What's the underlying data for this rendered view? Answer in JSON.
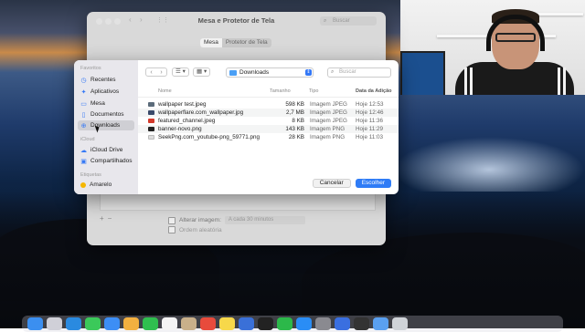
{
  "settings_window": {
    "title": "Mesa e Protetor de Tela",
    "search_placeholder": "Buscar",
    "tabs": [
      {
        "label": "Mesa",
        "active": true
      },
      {
        "label": "Protetor de Tela",
        "active": false
      }
    ],
    "change_picture_label": "Alterar imagem:",
    "change_picture_value": "A cada 30 minutos",
    "random_order_label": "Ordem aleatória"
  },
  "file_dialog": {
    "sidebar": {
      "favorites_header": "Favoritos",
      "favorites": [
        {
          "label": "Recentes",
          "icon": "clock-icon"
        },
        {
          "label": "Aplicativos",
          "icon": "apps-icon"
        },
        {
          "label": "Mesa",
          "icon": "desktop-icon"
        },
        {
          "label": "Documentos",
          "icon": "document-icon"
        },
        {
          "label": "Downloads",
          "icon": "download-icon",
          "selected": true
        }
      ],
      "icloud_header": "iCloud",
      "icloud": [
        {
          "label": "iCloud Drive",
          "icon": "cloud-icon"
        },
        {
          "label": "Compartilhados",
          "icon": "shared-folder-icon"
        }
      ],
      "tags_header": "Etiquetas",
      "tags": [
        {
          "label": "Amarelo",
          "color": "#f5b700"
        }
      ]
    },
    "toolbar": {
      "back": "‹",
      "forward": "›",
      "location": "Downloads",
      "search_placeholder": "Buscar"
    },
    "columns": {
      "name": "Nome",
      "size": "Tamanho",
      "kind": "Tipo",
      "date": "Data da Adição"
    },
    "files": [
      {
        "name": "wallpaper test.jpeg",
        "size": "598 KB",
        "kind": "Imagem JPEG",
        "date": "Hoje 12:53",
        "icon_color": "#5b6b7a"
      },
      {
        "name": "wallpaperflare.com_wallpaper.jpg",
        "size": "2,7 MB",
        "kind": "Imagem JPEG",
        "date": "Hoje 12:46",
        "icon_color": "#3a4a6a"
      },
      {
        "name": "featured_channel.jpeg",
        "size": "8 KB",
        "kind": "Imagem JPEG",
        "date": "Hoje 11:36",
        "icon_color": "#d33a2c"
      },
      {
        "name": "banner-novo.png",
        "size": "143 KB",
        "kind": "Imagem PNG",
        "date": "Hoje 11:29",
        "icon_color": "#222222"
      },
      {
        "name": "SeekPng.com_youtube-png_59771.png",
        "size": "28 KB",
        "kind": "Imagem PNG",
        "date": "Hoje 11:03",
        "icon_color": "#dddddd"
      }
    ],
    "buttons": {
      "cancel": "Cancelar",
      "choose": "Escolher"
    },
    "accent": "#2f7cf6"
  },
  "dock": {
    "icons": [
      "finder-icon",
      "launchpad-icon",
      "safari-icon",
      "messages-icon",
      "mail-icon",
      "photos-icon",
      "facetime-icon",
      "calendar-icon",
      "contacts-icon",
      "chrome-icon",
      "notes-icon",
      "keynote-icon",
      "appletv-icon",
      "numbers-icon",
      "appstore-icon",
      "settings-icon",
      "camera-icon",
      "terminal-icon",
      "downloads-stack-icon",
      "trash-icon"
    ]
  }
}
